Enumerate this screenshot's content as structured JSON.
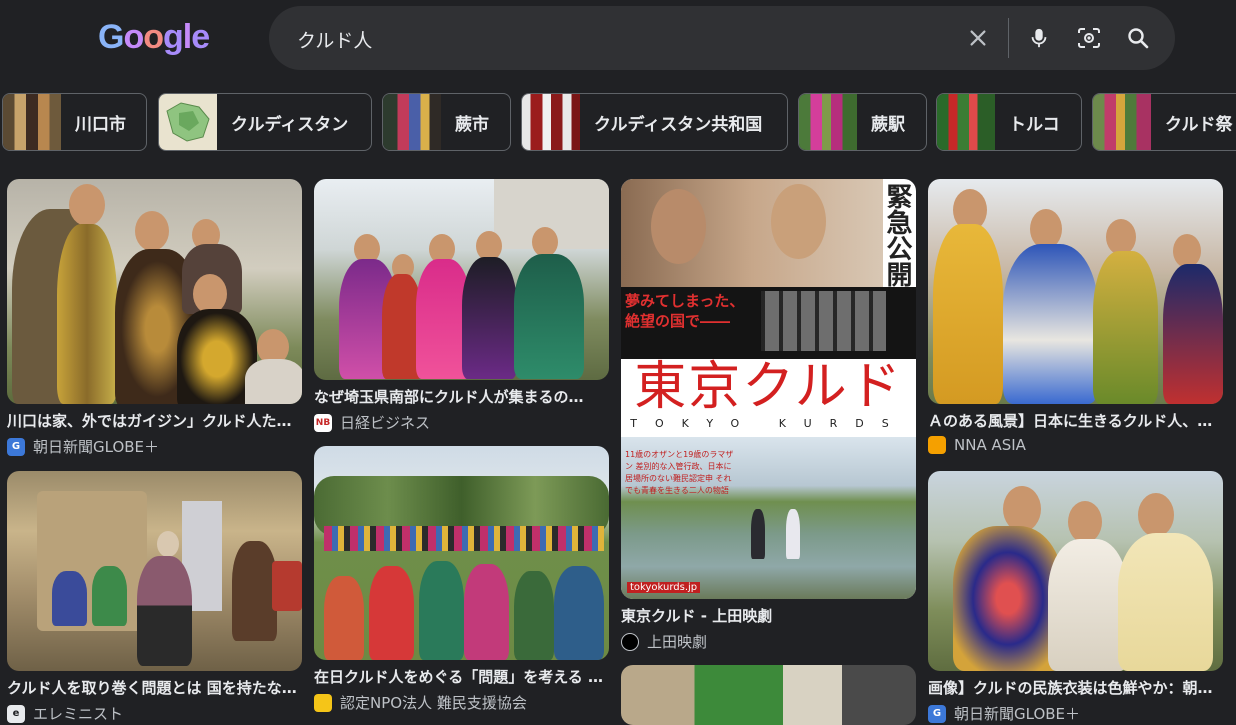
{
  "logo": {
    "letters": [
      "G",
      "o",
      "o",
      "g",
      "l",
      "e"
    ]
  },
  "search": {
    "query": "クルド人"
  },
  "chips": [
    {
      "label": "川口市"
    },
    {
      "label": "クルディスタン"
    },
    {
      "label": "蕨市"
    },
    {
      "label": "クルディスタン共和国"
    },
    {
      "label": "蕨駅"
    },
    {
      "label": "トルコ"
    },
    {
      "label": "クルド祭"
    }
  ],
  "results": [
    {
      "title": "川口は家、外ではガイジン」クルド人た…",
      "source": "朝日新聞GLOBE＋",
      "fav": "G"
    },
    {
      "title": "なぜ埼玉県南部にクルド人が集まるの…",
      "source": "日経ビジネス",
      "fav": "NB"
    },
    {
      "title": "東京クルド - 上田映劇",
      "source": "上田映劇",
      "fav": ""
    },
    {
      "title": "Ａのある風景】日本に生きるクルド人、…",
      "source": "NNA ASIA",
      "fav": ""
    },
    {
      "title": "クルド人を取り巻く問題とは 国を持たな…",
      "source": "エレミニスト",
      "fav": "e"
    },
    {
      "title": "在日クルド人をめぐる「問題」を考える …",
      "source": "認定NPO法人 難民支援協会",
      "fav": ""
    },
    {
      "title": "画像】クルドの民族衣装は色鮮やか：朝…",
      "source": "朝日新聞GLOBE＋",
      "fav": "G"
    }
  ],
  "poster": {
    "side_text": "緊急公開",
    "tagline": "夢みてしまった、絶望の国で――",
    "title": "東京クルド",
    "title_en": "TOKYO KURDS",
    "small_text": "11歳のオザンと19歳のラマザン 差別的な入管行政、日本に居場所のない難民認定申 それでも青春を生きる二人の物語",
    "url": "tokyokurds.jp"
  }
}
